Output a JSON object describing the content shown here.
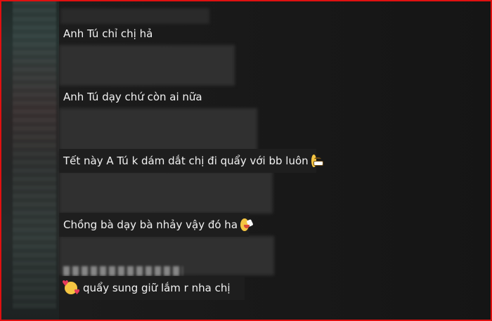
{
  "comments": [
    {
      "text": "Anh Tú chỉ chị hả",
      "emoji": ""
    },
    {
      "text": "Anh Tú dạy chứ còn ai nữa",
      "emoji": ""
    },
    {
      "text": "Tết này A Tú k dám dắt chị đi quẩy với bb luôn",
      "emoji": "grinning-face-icon"
    },
    {
      "text": "Chồng bà dạy bà nhảy vậy đó ha",
      "emoji": "rolling-laughing-face-icon"
    },
    {
      "text": "quẩy sung giữ lắm r nha chị",
      "emoji": "smiling-face-with-hearts-icon"
    }
  ],
  "colors": {
    "frame_border": "#e01010",
    "caption_text": "#f2f2f2",
    "background": "#141414"
  }
}
